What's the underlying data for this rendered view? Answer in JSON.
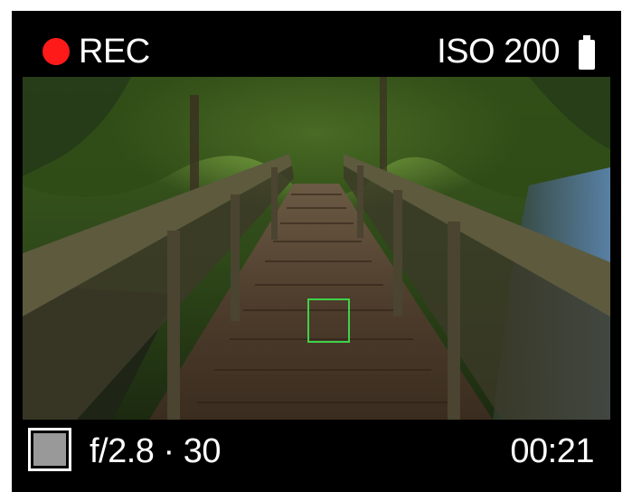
{
  "status": {
    "rec_label": "REC",
    "iso_label": "ISO 200",
    "battery_icon": "battery-full-icon",
    "rec_color": "#ff1a1a"
  },
  "viewfinder": {
    "focus_box_color": "#3fd24a"
  },
  "bottom": {
    "exposure_label": "f/2.8 · 30",
    "timer_label": "00:21",
    "thumbnail_icon": "gallery-thumbnail-icon"
  }
}
